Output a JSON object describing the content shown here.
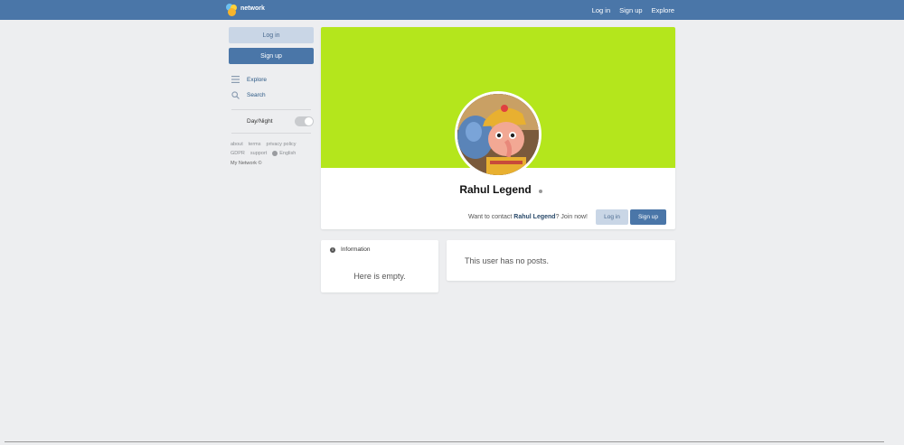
{
  "brand": {
    "name": "network"
  },
  "topnav": {
    "login": "Log in",
    "signup": "Sign up",
    "explore": "Explore"
  },
  "sidebar": {
    "login": "Log in",
    "signup": "Sign up",
    "items": [
      {
        "label": "Explore",
        "icon": "menu-icon"
      },
      {
        "label": "Search",
        "icon": "search-icon"
      }
    ],
    "daynight": "Day/Night",
    "footer_links": [
      "about",
      "terms",
      "privacy policy",
      "GDPR",
      "support",
      "English"
    ],
    "copyright": "My Network ©"
  },
  "profile": {
    "name": "Rahul Legend",
    "cover_color": "#b4e61c",
    "contact_prefix": "Want to contact ",
    "contact_name": "Rahul Legend",
    "contact_suffix": "? Join now!",
    "login": "Log in",
    "signup": "Sign up"
  },
  "info": {
    "title": "Information",
    "empty": "Here is empty."
  },
  "posts": {
    "empty": "This user has no posts."
  },
  "colors": {
    "accent": "#4a76a8",
    "light_button": "#c9d6e6",
    "background": "#edeef0"
  }
}
